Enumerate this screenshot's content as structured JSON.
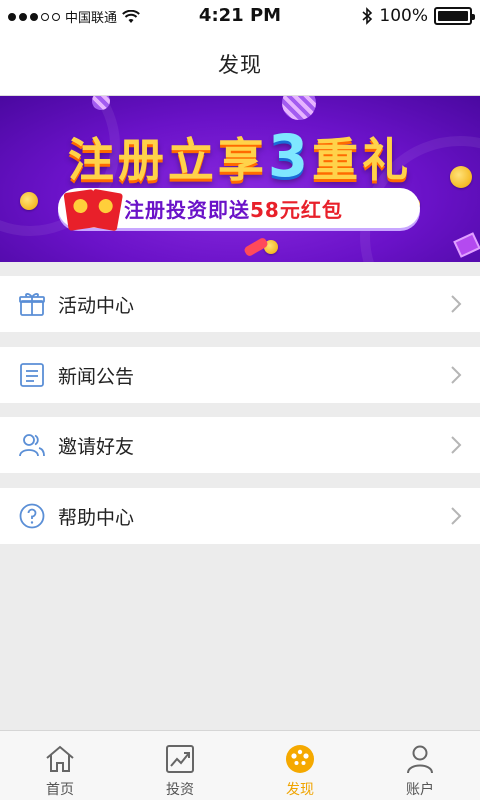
{
  "status_bar": {
    "carrier": "中国联通",
    "time": "4:21 PM",
    "battery_percent": "100%",
    "battery_level": 1.0,
    "signal_bars_filled": 3,
    "signal_bars_total": 5
  },
  "nav": {
    "title": "发现"
  },
  "banner": {
    "title_part1": "注册立享",
    "title_number": "3",
    "title_part2": "重礼",
    "promo_text": "注册投资即送",
    "promo_highlight": "58元红包",
    "colors": {
      "background": "#6a12c8",
      "title": "#ffd24a",
      "highlight": "#e8202a"
    }
  },
  "menu": {
    "items": [
      {
        "label": "活动中心",
        "icon": "gift-icon"
      },
      {
        "label": "新闻公告",
        "icon": "news-icon"
      },
      {
        "label": "邀请好友",
        "icon": "friends-icon"
      },
      {
        "label": "帮助中心",
        "icon": "help-icon"
      }
    ]
  },
  "tab_bar": {
    "tabs": [
      {
        "label": "首页",
        "icon": "home-icon",
        "active": false
      },
      {
        "label": "投资",
        "icon": "chart-icon",
        "active": false
      },
      {
        "label": "发现",
        "icon": "discover-icon",
        "active": true
      },
      {
        "label": "账户",
        "icon": "user-icon",
        "active": false
      }
    ],
    "active_color": "#f0a400"
  }
}
